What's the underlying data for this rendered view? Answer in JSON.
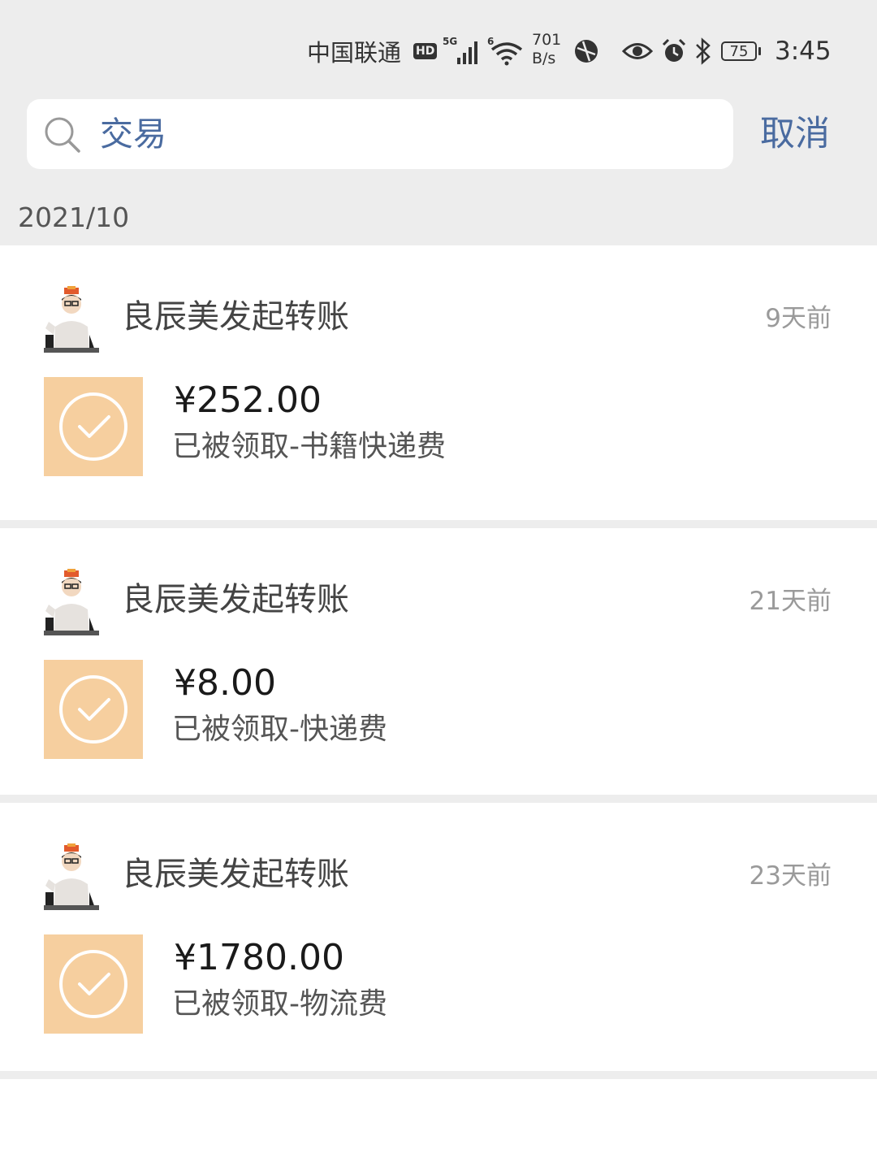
{
  "status_bar": {
    "carrier": "中国联通",
    "hd_badge": "HD",
    "signal_label": "5G",
    "wifi_label": "6",
    "speed_value": "701",
    "speed_unit": "B/s",
    "battery_level": "75",
    "time": "3:45"
  },
  "search": {
    "query": "交易",
    "cancel_label": "取消"
  },
  "month_header": "2021/10",
  "transfers": [
    {
      "sender": "良辰美发起转账",
      "time_ago": "9天前",
      "amount": "¥252.00",
      "remark": "已被领取-书籍快递费"
    },
    {
      "sender": "良辰美发起转账",
      "time_ago": "21天前",
      "amount": "¥8.00",
      "remark": "已被领取-快递费"
    },
    {
      "sender": "良辰美发起转账",
      "time_ago": "23天前",
      "amount": "¥1780.00",
      "remark": "已被领取-物流费"
    }
  ],
  "colors": {
    "accent": "#4a6ba0",
    "tile": "#f6cf9f",
    "background": "#ededed"
  },
  "icons": {
    "search": "search-icon",
    "received": "check-circle-icon"
  }
}
